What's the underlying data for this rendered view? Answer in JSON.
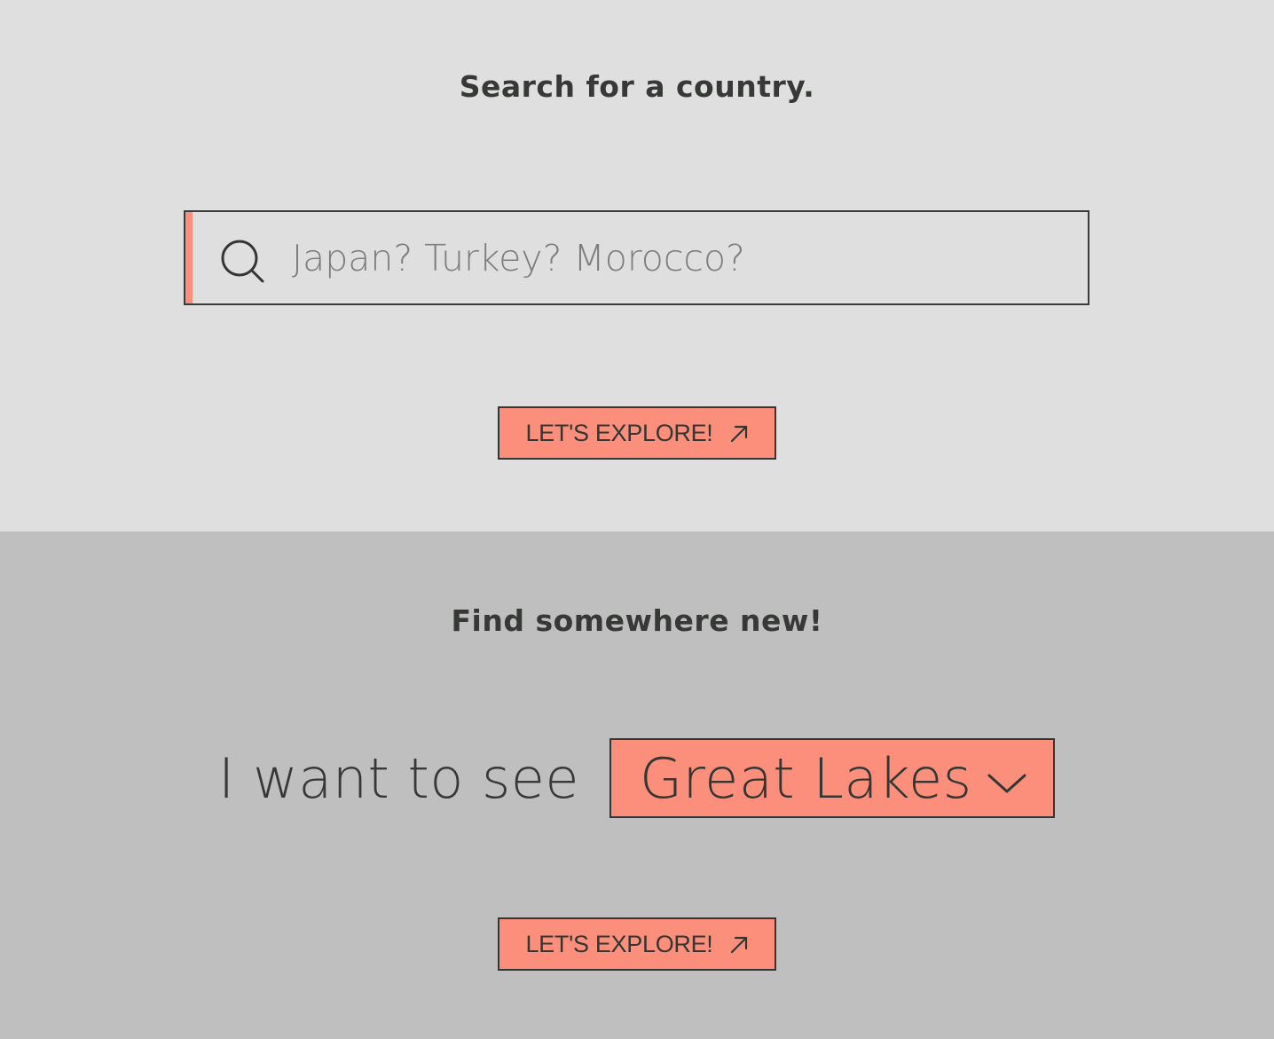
{
  "search_section": {
    "heading": "Search for a country.",
    "search": {
      "placeholder": "Japan? Turkey? Morocco?",
      "value": "",
      "icon": "search-icon"
    },
    "button": {
      "label": "LET'S EXPLORE!",
      "icon": "arrow-up-right-icon"
    }
  },
  "find_section": {
    "heading": "Find somewhere new!",
    "prompt": "I want to see",
    "dropdown": {
      "selected": "Great Lakes",
      "icon": "chevron-down-icon"
    },
    "button": {
      "label": "LET'S EXPLORE!",
      "icon": "arrow-up-right-icon"
    }
  },
  "colors": {
    "accent": "#fb8f7c",
    "top_background": "#dfdfdf",
    "bottom_background": "#bfbfbf",
    "text": "#333633"
  }
}
